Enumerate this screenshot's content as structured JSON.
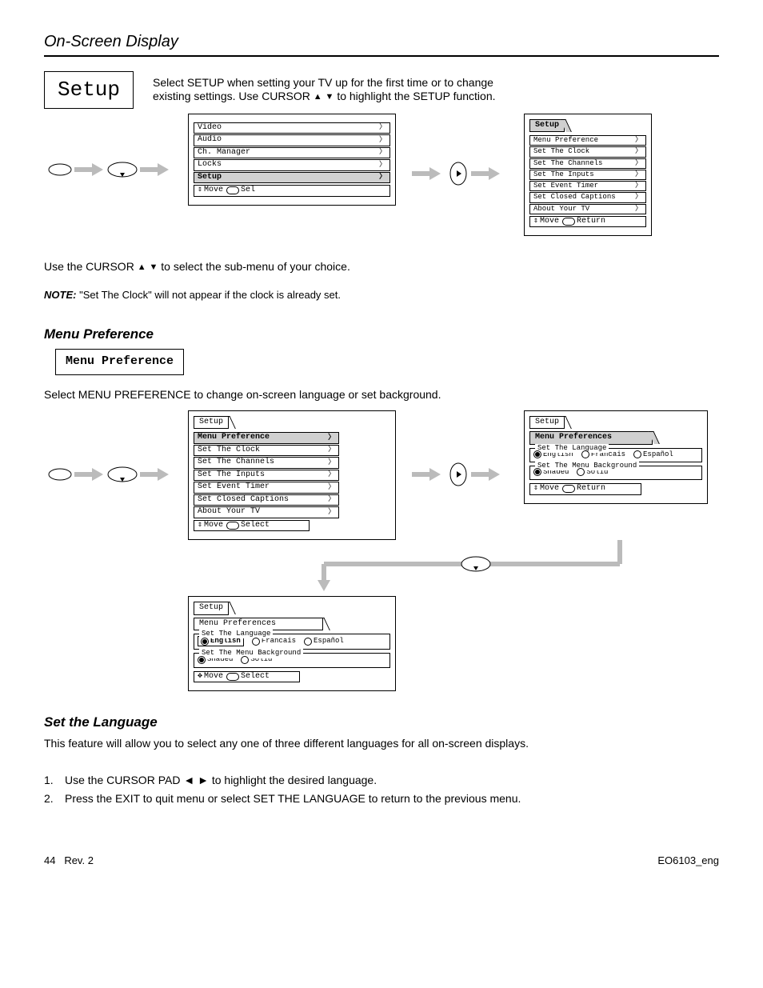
{
  "chapter_title": "On-Screen Display",
  "page_number": "44",
  "setup": {
    "box_label": "Setup",
    "intro_pre": "Select SETUP when setting your TV up for the first time or to change",
    "intro_post": "existing settings. Use CURSOR ",
    "intro_tail": " to highlight the SETUP function."
  },
  "flow1": {
    "left_menu": {
      "items": [
        "Video",
        "Audio",
        "Ch. Manager",
        "Locks",
        "Setup"
      ],
      "highlight_index": 4,
      "footer_move": "Move",
      "footer_sel": "Sel"
    },
    "right_title_tab": "Setup",
    "right_menu": {
      "items": [
        "Menu Preference",
        "Set The Clock",
        "Set The Channels",
        "Set The Inputs",
        "Set Event Timer",
        "Set Closed Captions",
        "About Your TV"
      ],
      "footer_move": "Move",
      "footer_return": "Return"
    }
  },
  "instr2_pre": "Use the CURSOR ",
  "instr2_post": " to select the sub-menu of your choice.",
  "note_label": "NOTE:",
  "note_text": "\"Set The Clock\" will not appear if the clock is already set.",
  "menu_pref": {
    "heading": "Menu Preference",
    "box_label": "Menu Preference",
    "proc_text": "Select MENU PREFERENCE to change on-screen language or set background."
  },
  "flow2": {
    "left": {
      "bc": "Setup",
      "items": [
        "Menu Preference",
        "Set The Clock",
        "Set The Channels",
        "Set The Inputs",
        "Set Event Timer",
        "Set Closed Captions",
        "About Your TV"
      ],
      "highlight_index": 0,
      "footer_move": "Move",
      "footer_select": "Select"
    },
    "right": {
      "bc1": "Setup",
      "bc2": "Menu Preferences",
      "lang_legend": "Set The Language",
      "lang_opts": [
        "English",
        "Francais",
        "Español"
      ],
      "lang_sel": 0,
      "bg_legend": "Set The Menu Background",
      "bg_opts": [
        "Shaded",
        "Solid"
      ],
      "bg_sel": 0,
      "footer_move": "Move",
      "footer_return": "Return"
    },
    "bottom": {
      "bc1": "Setup",
      "bc2": "Menu Preferences",
      "lang_legend": "Set The Language",
      "lang_opts": [
        "English",
        "Francais",
        "Español"
      ],
      "lang_sel_boxed": 0,
      "bg_legend": "Set The Menu Background",
      "bg_opts": [
        "Shaded",
        "Solid"
      ],
      "bg_sel": 0,
      "footer_move": "Move",
      "footer_select": "Select"
    }
  },
  "set_lang": {
    "heading": "Set the Language",
    "p": "This feature will allow you to select any one of three different languages for all on-screen displays.",
    "steps": [
      "Use the CURSOR PAD ◄ ► to highlight the desired language.",
      "Press the EXIT to quit menu or select SET THE LANGUAGE to return to the previous menu."
    ]
  },
  "footer_left": "Rev. 2",
  "footer_right": "EO6103_eng"
}
